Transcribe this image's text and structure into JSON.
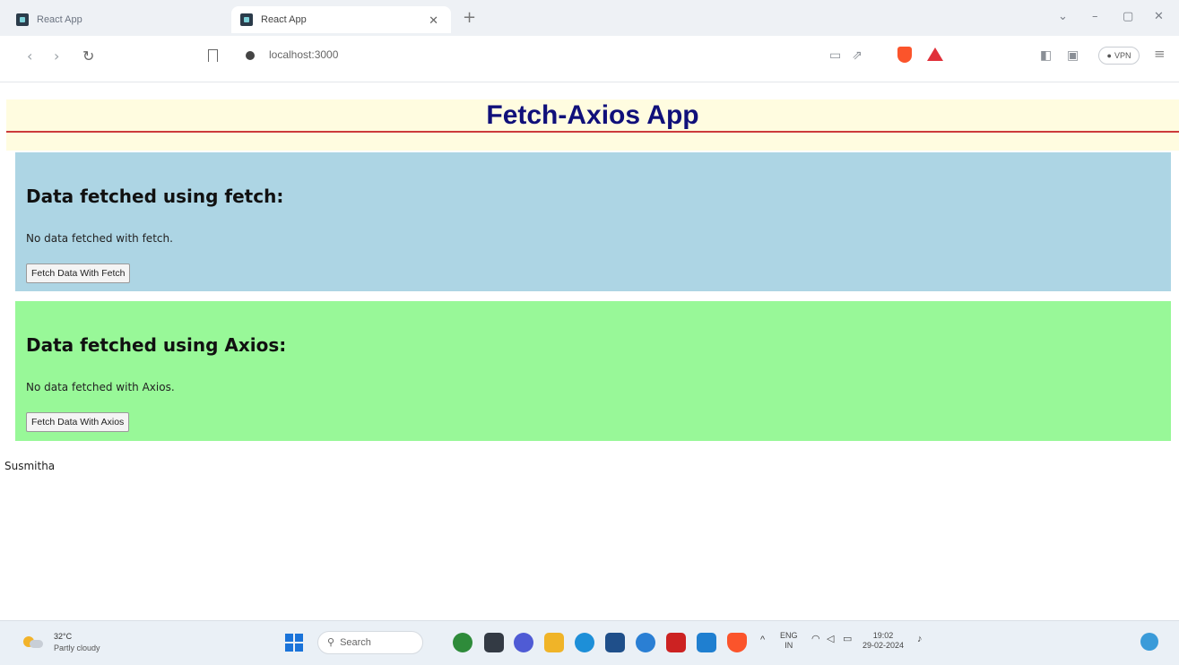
{
  "browser": {
    "tabs": [
      {
        "title": "React App",
        "active": false
      },
      {
        "title": "React App",
        "active": true
      }
    ],
    "url": "localhost:3000",
    "vpn_label": "VPN",
    "window_controls": [
      "⌄",
      "–",
      "▢",
      "✕"
    ]
  },
  "page": {
    "title": "Fetch-Axios App",
    "fetch_section": {
      "heading": "Data fetched using fetch:",
      "message": "No data fetched with fetch.",
      "button_label": "Fetch Data With Fetch",
      "background": "#add5e4"
    },
    "axios_section": {
      "heading": "Data fetched using Axios:",
      "message": "No data fetched with Axios.",
      "button_label": "Fetch Data With Axios",
      "background": "#98f898"
    },
    "footer_name": "Susmitha",
    "header_color": "#10107a",
    "header_background": "#fffce0",
    "header_border": "#cc3b3b"
  },
  "taskbar": {
    "temperature": "32°C",
    "condition": "Partly cloudy",
    "search_placeholder": "Search",
    "language": "ENG",
    "region": "IN",
    "time": "19:02",
    "date": "29-02-2024"
  }
}
